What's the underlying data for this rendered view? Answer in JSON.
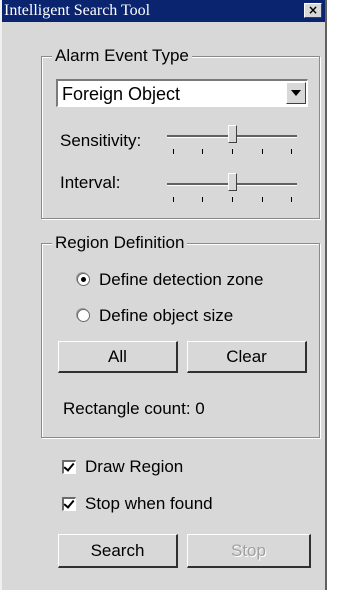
{
  "window": {
    "title": "Intelligent Search Tool",
    "close_glyph": "×"
  },
  "alarm_group": {
    "legend": "Alarm Event Type",
    "select_value": "Foreign Object",
    "sensitivity_label": "Sensitivity:",
    "sensitivity_level": 0.5,
    "interval_label": "Interval:",
    "interval_level": 0.5
  },
  "region_group": {
    "legend": "Region Definition",
    "radio_detection_zone": "Define detection zone",
    "radio_object_size": "Define object size",
    "selected_radio": "Define detection zone",
    "all_button": "All",
    "clear_button": "Clear",
    "rectangle_count": "Rectangle count: 0"
  },
  "options": {
    "draw_region": "Draw Region",
    "draw_region_checked": true,
    "stop_when_found": "Stop when found",
    "stop_when_found_checked": true
  },
  "actions": {
    "search_button": "Search",
    "stop_button": "Stop",
    "stop_enabled": false
  },
  "colors": {
    "titlebar": "#0a2470",
    "face": "#d8d8d8"
  }
}
